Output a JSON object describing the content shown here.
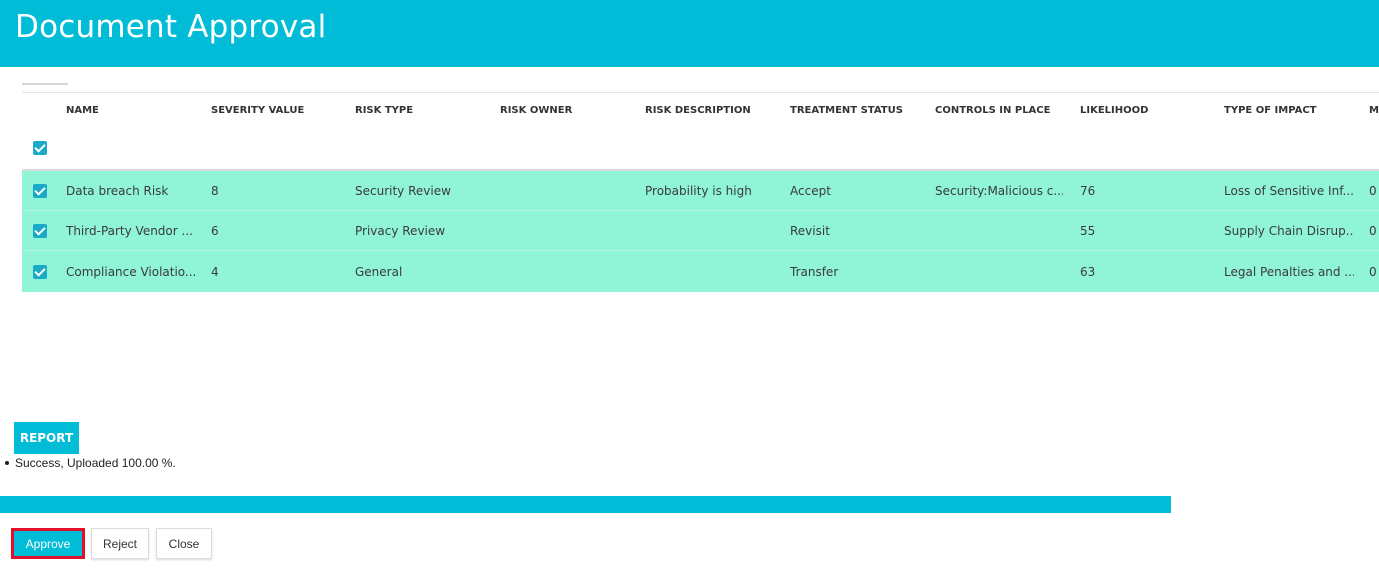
{
  "header": {
    "title": "Document Approval"
  },
  "table": {
    "columns": [
      "NAME",
      "SEVERITY VALUE",
      "RISK TYPE",
      "RISK OWNER",
      "RISK DESCRIPTION",
      "TREATMENT STATUS",
      "CONTROLS IN PLACE",
      "LIKELIHOOD",
      "TYPE OF IMPACT",
      "M"
    ],
    "select_all_checked": true,
    "rows": [
      {
        "checked": true,
        "name": "Data breach Risk",
        "severity": "8",
        "risk_type": "Security Review",
        "owner": "",
        "description": "Probability is high",
        "treatment": "Accept",
        "controls": "Security:Malicious c...",
        "likelihood": "76",
        "impact": "Loss of Sensitive Inf...",
        "m": "0"
      },
      {
        "checked": true,
        "name": "Third-Party Vendor ...",
        "severity": "6",
        "risk_type": "Privacy Review",
        "owner": "",
        "description": "",
        "treatment": "Revisit",
        "controls": "",
        "likelihood": "55",
        "impact": "Supply Chain Disrup...",
        "m": "0"
      },
      {
        "checked": true,
        "name": "Compliance Violatio...",
        "severity": "4",
        "risk_type": "General",
        "owner": "",
        "description": "",
        "treatment": "Transfer",
        "controls": "",
        "likelihood": "63",
        "impact": "Legal Penalties and ...",
        "m": "0"
      }
    ]
  },
  "report": {
    "label": "REPORT",
    "messages": [
      "Success, Uploaded 100.00 %."
    ],
    "progress_percent": 100
  },
  "actions": {
    "approve": "Approve",
    "reject": "Reject",
    "close": "Close"
  },
  "colors": {
    "accent": "#00bcd6",
    "row_highlight": "#90f5d6",
    "checkbox": "#1aa9c7",
    "approve_focus_border": "#e0102c"
  }
}
